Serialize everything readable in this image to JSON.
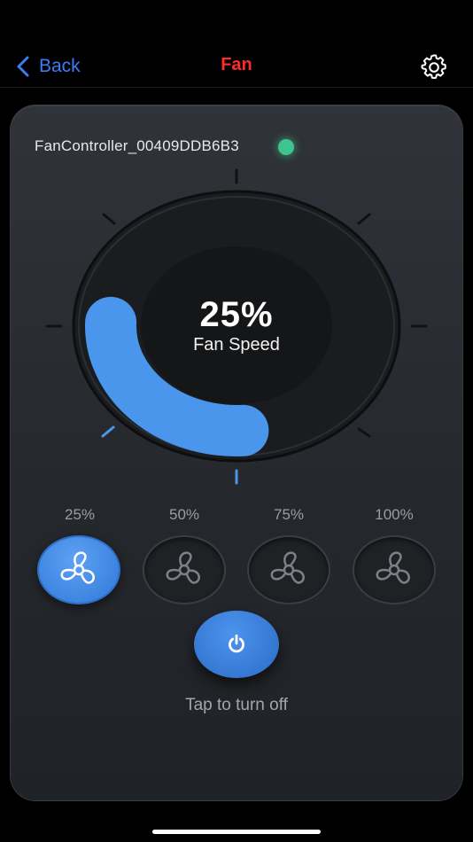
{
  "nav": {
    "back_label": "Back",
    "title": "Fan",
    "settings_icon": "gear-icon"
  },
  "device": {
    "name": "FanController_00409DDB6B3",
    "status_color": "#3ec48f"
  },
  "gauge": {
    "value": 25,
    "value_text": "25%",
    "label": "Fan Speed",
    "accent": "#4a96ec"
  },
  "speeds": [
    {
      "label": "25%",
      "active": true
    },
    {
      "label": "50%",
      "active": false
    },
    {
      "label": "75%",
      "active": false
    },
    {
      "label": "100%",
      "active": false
    }
  ],
  "power": {
    "icon": "power-icon",
    "hint": "Tap to turn off"
  },
  "colors": {
    "title": "#ff2a2a",
    "link": "#3d7cf2"
  }
}
